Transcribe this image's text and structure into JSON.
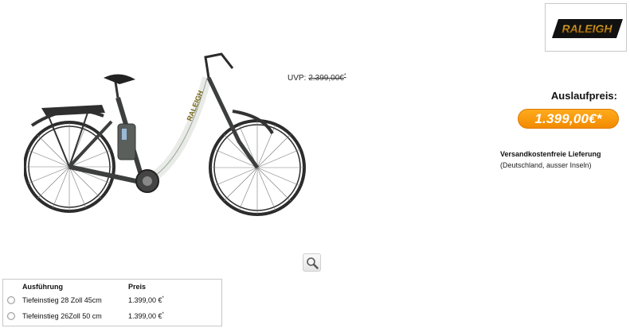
{
  "product": {
    "image_alt": "Raleigh E-Bike Tiefeinstieg",
    "uvp_label": "UVP:",
    "uvp_price": "2.399,00€",
    "uvp_asterisk": "*",
    "sale_label": "Auslaufpreis:",
    "sale_price": "1.399,00€*",
    "shipping_title": "Versandkostenfreie Lieferung",
    "shipping_note": "(Deutschland, ausser Inseln)",
    "brand": "RALEIGH",
    "zoom_icon": "magnifier-icon"
  },
  "variants": {
    "headers": {
      "variant": "Ausführung",
      "price": "Preis"
    },
    "rows": [
      {
        "name": "Tiefeinstieg 28 Zoll 45cm",
        "price": "1.399,00 €",
        "asterisk": "*",
        "selected": false
      },
      {
        "name": "Tiefeinstieg 26Zoll 50 cm",
        "price": "1.399,00 €",
        "asterisk": "*",
        "selected": false
      }
    ]
  },
  "colors": {
    "accent_orange": "#f28a00",
    "frame_white": "#e8ebe6",
    "frame_dark": "#3c3f3d"
  }
}
